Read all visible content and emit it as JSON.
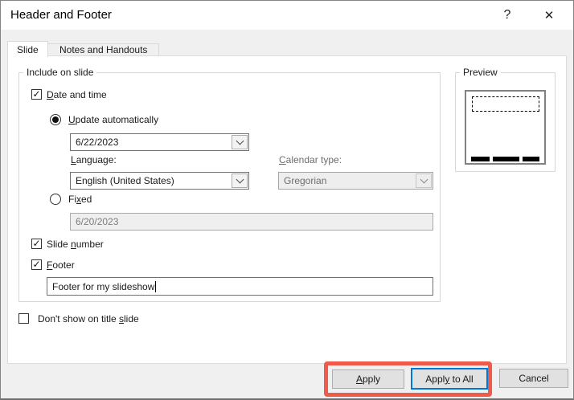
{
  "window": {
    "title": "Header and Footer"
  },
  "icons": {
    "help": "?",
    "close": "✕",
    "check": "✓"
  },
  "tabs": [
    {
      "label": "Slide"
    },
    {
      "label": "Notes and Handouts"
    }
  ],
  "include_group": {
    "title": "Include on slide",
    "date_time": {
      "pre": "",
      "key": "D",
      "post": "ate and time",
      "checked": true
    },
    "update_auto": {
      "pre": "",
      "key": "U",
      "post": "pdate automatically",
      "selected": true
    },
    "date_value": "6/22/2023",
    "language_label": {
      "pre": "",
      "key": "L",
      "post": "anguage:"
    },
    "language_value": "English (United States)",
    "calendar_label": {
      "pre": "",
      "key": "C",
      "post": "alendar type:"
    },
    "calendar_value": "Gregorian",
    "fixed": {
      "pre": "Fi",
      "key": "x",
      "post": "ed",
      "selected": false
    },
    "fixed_value": "6/20/2023",
    "slide_number": {
      "pre": "Slide ",
      "key": "n",
      "post": "umber",
      "checked": true
    },
    "footer": {
      "pre": "",
      "key": "F",
      "post": "ooter",
      "checked": true
    },
    "footer_value": "Footer for my slideshow"
  },
  "dont_show": {
    "pre": "Don't show on title ",
    "key": "s",
    "post": "lide",
    "checked": false
  },
  "preview_group": {
    "title": "Preview"
  },
  "buttons": {
    "apply": {
      "pre": "",
      "key": "A",
      "post": "pply"
    },
    "apply_all": {
      "pre": "Appl",
      "key": "y",
      "post": " to All"
    },
    "cancel": "Cancel"
  },
  "colors": {
    "focus_blue": "#0078d7",
    "annotation_red": "#ef5b4b"
  }
}
